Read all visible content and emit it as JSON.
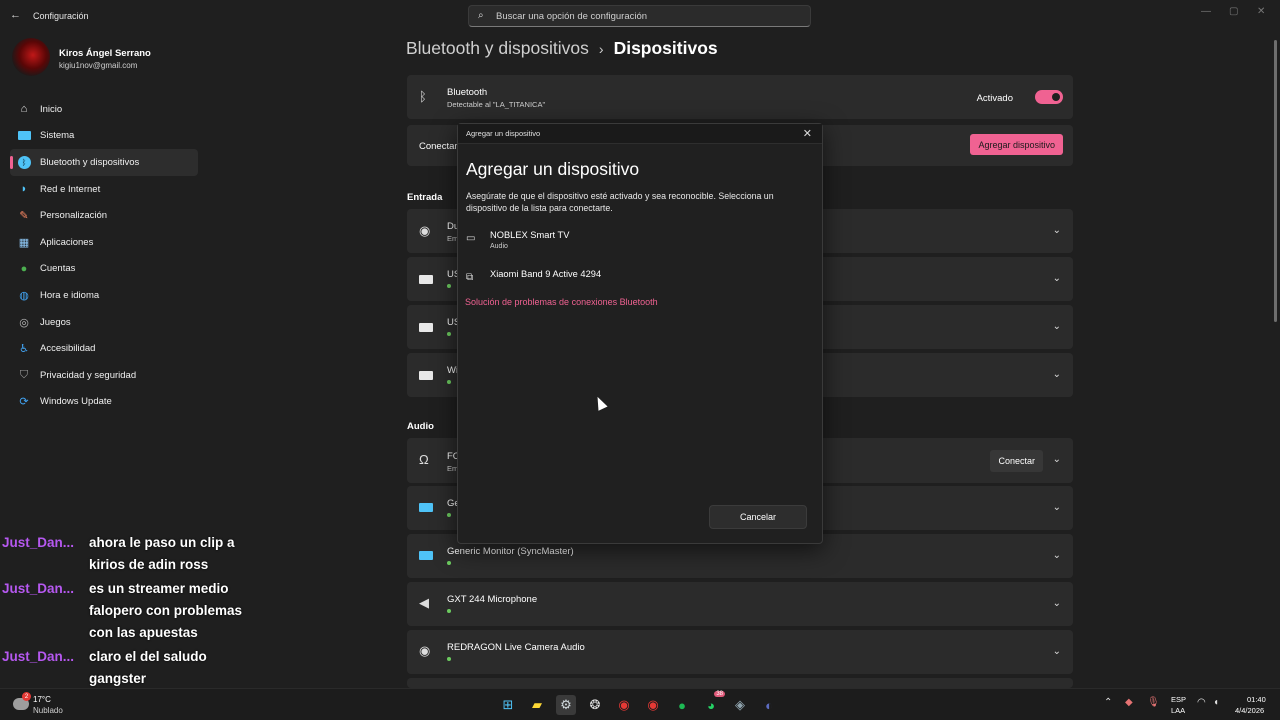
{
  "window": {
    "title": "Configuración",
    "search_placeholder": "Buscar una opción de configuración"
  },
  "profile": {
    "name": "Kiros Ángel Serrano",
    "email": "kigiu1nov@gmail.com"
  },
  "nav": {
    "items": [
      {
        "label": "Inicio",
        "icon": "home-icon",
        "color": "#e0e0e0"
      },
      {
        "label": "Sistema",
        "icon": "system-icon",
        "color": "#4fc3f7"
      },
      {
        "label": "Bluetooth y dispositivos",
        "icon": "bluetooth-icon",
        "color": "#4fc3f7"
      },
      {
        "label": "Red e Internet",
        "icon": "wifi-icon",
        "color": "#4fc3f7"
      },
      {
        "label": "Personalización",
        "icon": "brush-icon",
        "color": "#ff8a65"
      },
      {
        "label": "Aplicaciones",
        "icon": "apps-icon",
        "color": "#90caf9"
      },
      {
        "label": "Cuentas",
        "icon": "account-icon",
        "color": "#4caf50"
      },
      {
        "label": "Hora e idioma",
        "icon": "globe-icon",
        "color": "#42a5f5"
      },
      {
        "label": "Juegos",
        "icon": "gamepad-icon",
        "color": "#bdbdbd"
      },
      {
        "label": "Accesibilidad",
        "icon": "accessibility-icon",
        "color": "#42a5f5"
      },
      {
        "label": "Privacidad y seguridad",
        "icon": "shield-icon",
        "color": "#9e9e9e"
      },
      {
        "label": "Windows Update",
        "icon": "update-icon",
        "color": "#42a5f5"
      }
    ],
    "active_index": 2
  },
  "breadcrumb": {
    "parent": "Bluetooth y dispositivos",
    "separator": "›",
    "current": "Dispositivos"
  },
  "bluetooth_card": {
    "title": "Bluetooth",
    "subtitle": "Detectable al \"LA_TITANICA\"",
    "toggle_label": "Activado",
    "toggle_on": true
  },
  "connect_card": {
    "label": "Conectar",
    "button": "Agregar dispositivo"
  },
  "sections": {
    "entrada": "Entrada",
    "audio": "Audio"
  },
  "entrada_rows": [
    {
      "title": "Du",
      "subtitle": "Em"
    },
    {
      "title": "US",
      "subtitle": ""
    },
    {
      "title": "US",
      "subtitle": ""
    },
    {
      "title": "Wi",
      "subtitle": ""
    }
  ],
  "audio_rows": [
    {
      "title": "FO",
      "subtitle": "Em",
      "button": "Conectar"
    },
    {
      "title": "Ge",
      "subtitle": ""
    },
    {
      "title": "Generic Monitor (SyncMaster)",
      "subtitle": ""
    },
    {
      "title": "GXT 244 Microphone",
      "subtitle": ""
    },
    {
      "title": "REDRAGON Live Camera Audio",
      "subtitle": ""
    }
  ],
  "dialog": {
    "caption": "Agregar un dispositivo",
    "heading": "Agregar un dispositivo",
    "description": "Asegúrate de que el dispositivo esté activado y sea reconocible. Selecciona un dispositivo de la lista para conectarte.",
    "devices": [
      {
        "name": "NOBLEX Smart TV",
        "sub": "Audio",
        "icon": "monitor-icon"
      },
      {
        "name": "Xiaomi Band 9 Active 4294",
        "sub": "",
        "icon": "devices-icon"
      }
    ],
    "link": "Solución de problemas de conexiones Bluetooth",
    "cancel": "Cancelar"
  },
  "chat": [
    {
      "user": "Just_Dan...",
      "text": "ahora le paso un clip a kirios de adin ross"
    },
    {
      "user": "Just_Dan...",
      "text": "es un streamer medio falopero con problemas con las apuestas"
    },
    {
      "user": "Just_Dan...",
      "text": "claro el del saludo gangster"
    }
  ],
  "taskbar": {
    "weather_temp": "17°C",
    "weather_desc": "Nublado",
    "weather_badge": "2",
    "whatsapp_badge": "38",
    "lang_top": "ESP",
    "lang_bottom": "LAA",
    "time": "01:40",
    "date": "4/4/2026"
  },
  "colors": {
    "accent": "#f06292",
    "background": "#1f1f1f",
    "card": "#2b2b2b"
  }
}
